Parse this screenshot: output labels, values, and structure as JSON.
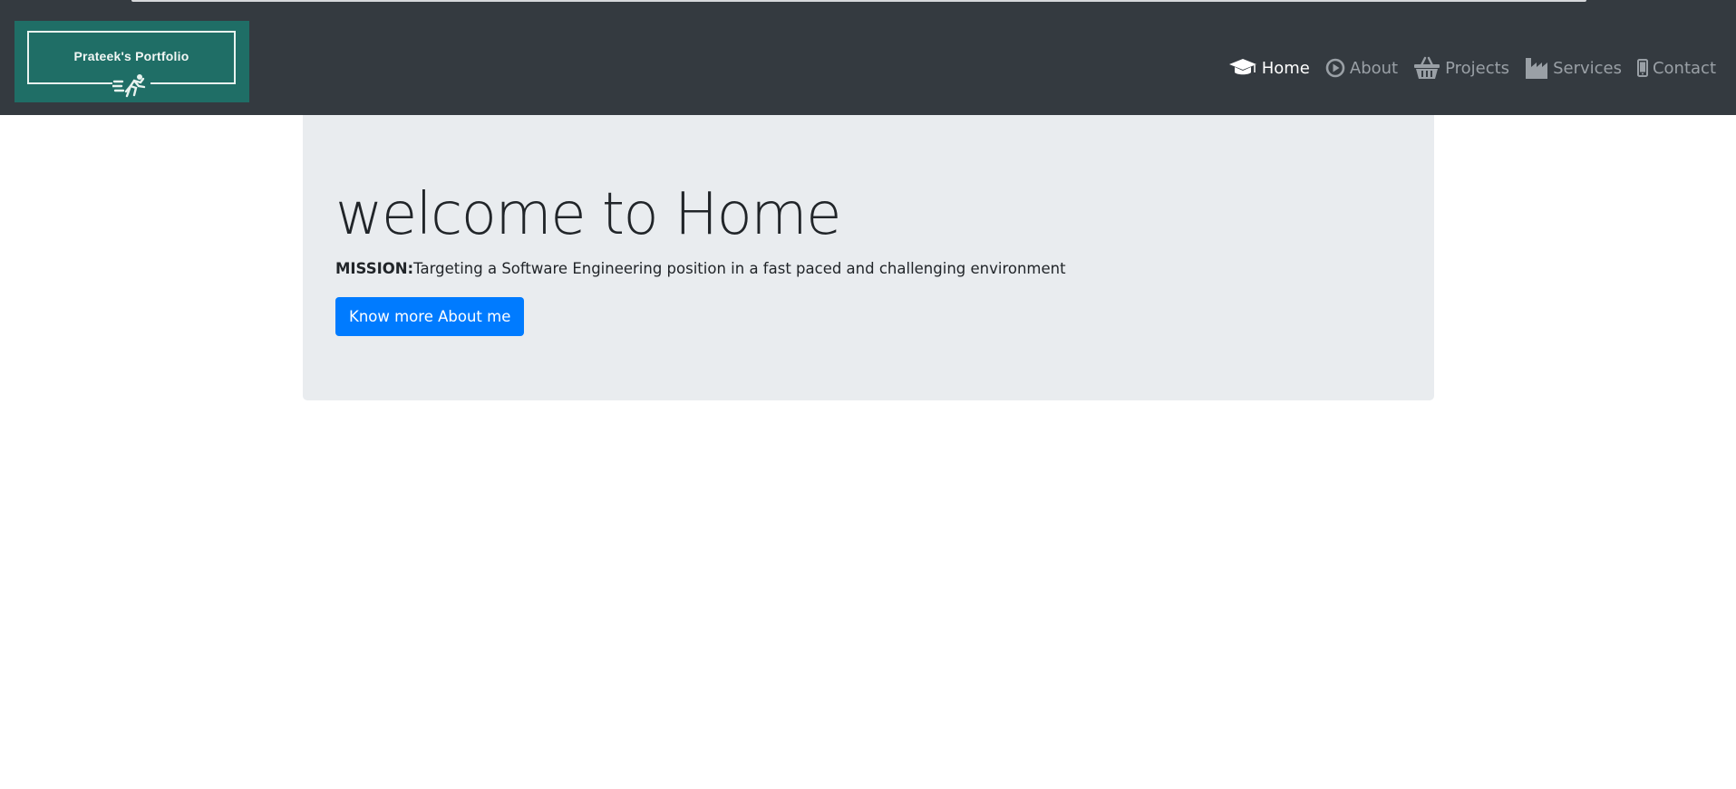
{
  "logo": {
    "text": "Prateek's Portfolio",
    "runner_icon": "running-man-icon"
  },
  "nav": {
    "items": [
      {
        "label": "Home",
        "icon": "graduation-cap-icon",
        "active": true
      },
      {
        "label": "About",
        "icon": "play-circle-icon",
        "active": false
      },
      {
        "label": "Projects",
        "icon": "shopping-basket-icon",
        "active": false
      },
      {
        "label": "Services",
        "icon": "industry-icon",
        "active": false
      },
      {
        "label": "Contact",
        "icon": "mobile-phone-icon",
        "active": false
      }
    ]
  },
  "hero": {
    "title": "welcome to Home",
    "mission_label": "MISSION:",
    "mission_text": "Targeting a Software Engineering position in a fast paced and challenging environment",
    "button_label": "Know more About me"
  },
  "colors": {
    "navbar": "#343a40",
    "jumbotron": "#e9ecef",
    "primary_button": "#007bff",
    "logo_background": "#1f6e66",
    "nav_inactive": "#9aa0a6",
    "nav_active": "#ffffff"
  }
}
